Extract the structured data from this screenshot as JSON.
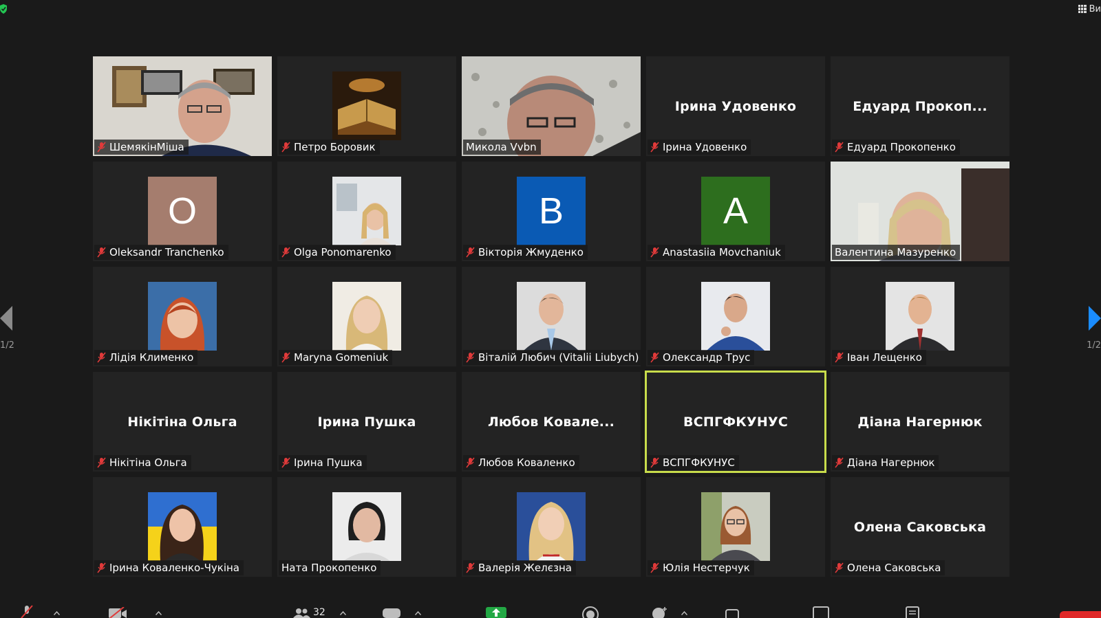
{
  "window": {
    "view_label": "Ви"
  },
  "colors": {
    "active_speaker": "#c8dc4b",
    "muted_icon": "#e03a3a",
    "share_green": "#23a845",
    "end_red": "#e02828"
  },
  "gallery": {
    "page_indicator": "1/2",
    "tiles": [
      {
        "label": "ШемякінМіша",
        "type": "video",
        "muted": true
      },
      {
        "label": "Петро Боровик",
        "type": "photo",
        "muted": true
      },
      {
        "label": "Микола Vvbn",
        "type": "video",
        "muted": false
      },
      {
        "label": "Ірина Удовенко",
        "big_name": "Ірина Удовенко",
        "type": "name",
        "muted": true
      },
      {
        "label": "Едуард Прокопенко",
        "big_name": "Едуард  Прокоп...",
        "type": "name",
        "muted": true
      },
      {
        "label": "Oleksandr Tranchenko",
        "initial": "O",
        "initial_color": "#a57d6e",
        "type": "initial",
        "muted": true
      },
      {
        "label": "Olga Ponomarenko",
        "type": "photo",
        "muted": true
      },
      {
        "label": "Вікторія Жмуденко",
        "initial": "B",
        "initial_color": "#0a5ab4",
        "type": "initial",
        "muted": true
      },
      {
        "label": "Anastasiia Movchaniuk",
        "initial": "A",
        "initial_color": "#2d6e1e",
        "type": "initial",
        "muted": true
      },
      {
        "label": "Валентина Мазуренко",
        "type": "video",
        "muted": false
      },
      {
        "label": "Лідія Клименко",
        "type": "photo",
        "muted": true
      },
      {
        "label": "Maryna Gomeniuk",
        "type": "photo",
        "muted": true
      },
      {
        "label": "Віталій Любич (Vitalii Liubych)",
        "type": "photo",
        "muted": true
      },
      {
        "label": "Олександр Трус",
        "type": "photo",
        "muted": true
      },
      {
        "label": "Іван Лещенко",
        "type": "photo",
        "muted": true
      },
      {
        "label": "Нікітіна Ольга",
        "big_name": "Нікітіна Ольга",
        "type": "name",
        "muted": true
      },
      {
        "label": "Ірина Пушка",
        "big_name": "Ірина Пушка",
        "type": "name",
        "muted": true
      },
      {
        "label": "Любов Коваленко",
        "big_name": "Любов  Ковале...",
        "type": "name",
        "muted": true
      },
      {
        "label": "ВСПГФКУНУС",
        "big_name": "ВСПГФКУНУС",
        "type": "name",
        "muted": true,
        "active": true
      },
      {
        "label": "Діана Нагернюк",
        "big_name": "Діана Нагернюк",
        "type": "name",
        "muted": true
      },
      {
        "label": "Ірина Коваленко-Чукіна",
        "type": "photo",
        "muted": true
      },
      {
        "label": "Ната Прокопенко",
        "type": "photo",
        "muted": false
      },
      {
        "label": "Валерія Желєзна",
        "type": "photo",
        "muted": true
      },
      {
        "label": "Юлія Нестерчук",
        "type": "photo",
        "muted": true
      },
      {
        "label": "Олена Саковська",
        "big_name": "Олена Саковська",
        "type": "name",
        "muted": true
      }
    ]
  },
  "toolbar": {
    "participants_count": "32"
  }
}
